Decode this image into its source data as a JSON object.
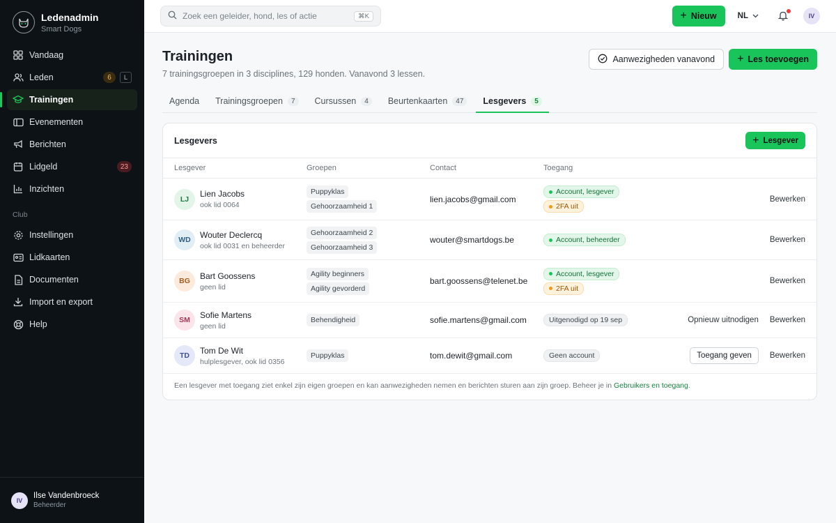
{
  "brand": {
    "name": "Ledenadmin",
    "sub": "Smart Dogs"
  },
  "sidebar": {
    "items": [
      {
        "label": "Vandaag",
        "icon": "grid-icon"
      },
      {
        "label": "Leden",
        "icon": "users-icon",
        "badge": "6",
        "kbd": "L"
      },
      {
        "label": "Trainingen",
        "icon": "graduation-cap-icon",
        "active": true
      },
      {
        "label": "Evenementen",
        "icon": "ticket-icon"
      },
      {
        "label": "Berichten",
        "icon": "megaphone-icon"
      },
      {
        "label": "Lidgeld",
        "icon": "calendar-icon",
        "badge": "23"
      },
      {
        "label": "Inzichten",
        "icon": "bar-chart-icon"
      }
    ],
    "section_label": "Club",
    "club_items": [
      {
        "label": "Instellingen",
        "icon": "gear-icon"
      },
      {
        "label": "Lidkaarten",
        "icon": "id-card-icon"
      },
      {
        "label": "Documenten",
        "icon": "document-icon"
      },
      {
        "label": "Import en export",
        "icon": "download-icon"
      },
      {
        "label": "Help",
        "icon": "lifebuoy-icon"
      }
    ],
    "user": {
      "initials": "IV",
      "name": "Ilse Vandenbroeck",
      "role": "Beheerder"
    }
  },
  "topbar": {
    "search_placeholder": "Zoek een geleider, hond, les of actie",
    "search_kbd": "⌘K",
    "new_label": "Nieuw",
    "lang": "NL",
    "avatar": "IV"
  },
  "page": {
    "title": "Trainingen",
    "subtitle": "7 trainingsgroepen in 3 disciplines, 129 honden. Vanavond 3 lessen.",
    "attendance_label": "Aanwezigheden vanavond",
    "add_lesson_label": "Les toevoegen"
  },
  "tabs": [
    {
      "label": "Agenda",
      "count": ""
    },
    {
      "label": "Trainingsgroepen",
      "count": "7"
    },
    {
      "label": "Cursussen",
      "count": "4"
    },
    {
      "label": "Beurtenkaarten",
      "count": "47"
    },
    {
      "label": "Lesgevers",
      "count": "5",
      "active": true
    }
  ],
  "card": {
    "title": "Lesgevers",
    "add_label": "Lesgever",
    "columns": [
      "Lesgever",
      "Groepen",
      "Contact",
      "Toegang"
    ],
    "rows": [
      {
        "initials": "LJ",
        "name": "Lien Jacobs",
        "meta": "ook lid 0064",
        "avatar_bg": "#e3f4e8",
        "avatar_fg": "#1f7a44",
        "groups": [
          "Puppyklas",
          "Gehoorzaamheid 1"
        ],
        "email": "lien.jacobs@gmail.com",
        "access": [
          {
            "label": "Account, lesgever",
            "kind": "ok"
          },
          {
            "label": "2FA uit",
            "kind": "warn"
          }
        ],
        "action": "",
        "edit": "Bewerken"
      },
      {
        "initials": "WD",
        "name": "Wouter Declercq",
        "meta": "ook lid 0031 en beheerder",
        "avatar_bg": "#e2eef6",
        "avatar_fg": "#2f5f83",
        "groups": [
          "Gehoorzaamheid 2",
          "Gehoorzaamheid 3"
        ],
        "email": "wouter@smartdogs.be",
        "access": [
          {
            "label": "Account, beheerder",
            "kind": "ok"
          }
        ],
        "action": "",
        "edit": "Bewerken"
      },
      {
        "initials": "BG",
        "name": "Bart Goossens",
        "meta": "geen lid",
        "avatar_bg": "#fcebdc",
        "avatar_fg": "#a45a1c",
        "groups": [
          "Agility beginners",
          "Agility gevorderd"
        ],
        "email": "bart.goossens@telenet.be",
        "access": [
          {
            "label": "Account, lesgever",
            "kind": "ok"
          },
          {
            "label": "2FA uit",
            "kind": "warn"
          }
        ],
        "action": "",
        "edit": "Bewerken"
      },
      {
        "initials": "SM",
        "name": "Sofie Martens",
        "meta": "geen lid",
        "avatar_bg": "#fbe4ea",
        "avatar_fg": "#a13a58",
        "groups": [
          "Behendigheid"
        ],
        "email": "sofie.martens@gmail.com",
        "access": [
          {
            "label": "Uitgenodigd op 19 sep",
            "kind": "neutral"
          }
        ],
        "action": "Opnieuw uitnodigen",
        "action_kind": "link",
        "edit": "Bewerken"
      },
      {
        "initials": "TD",
        "name": "Tom De Wit",
        "meta": "hulplesgever, ook lid 0356",
        "avatar_bg": "#e4e8f8",
        "avatar_fg": "#3f4f94",
        "groups": [
          "Puppyklas"
        ],
        "email": "tom.dewit@gmail.com",
        "access": [
          {
            "label": "Geen account",
            "kind": "neutral"
          }
        ],
        "action": "Toegang geven",
        "action_kind": "button",
        "edit": "Bewerken"
      }
    ],
    "footer_text": "Een lesgever met toegang ziet enkel zijn eigen groepen en kan aanwezigheden nemen en berichten sturen aan zijn groep. Beheer je in ",
    "footer_link": "Gebruikers en toegang",
    "footer_end": "."
  },
  "colors": {
    "accent": "#19c55a",
    "sidebar_bg": "#0d1216",
    "warn": "#f29a1a"
  }
}
